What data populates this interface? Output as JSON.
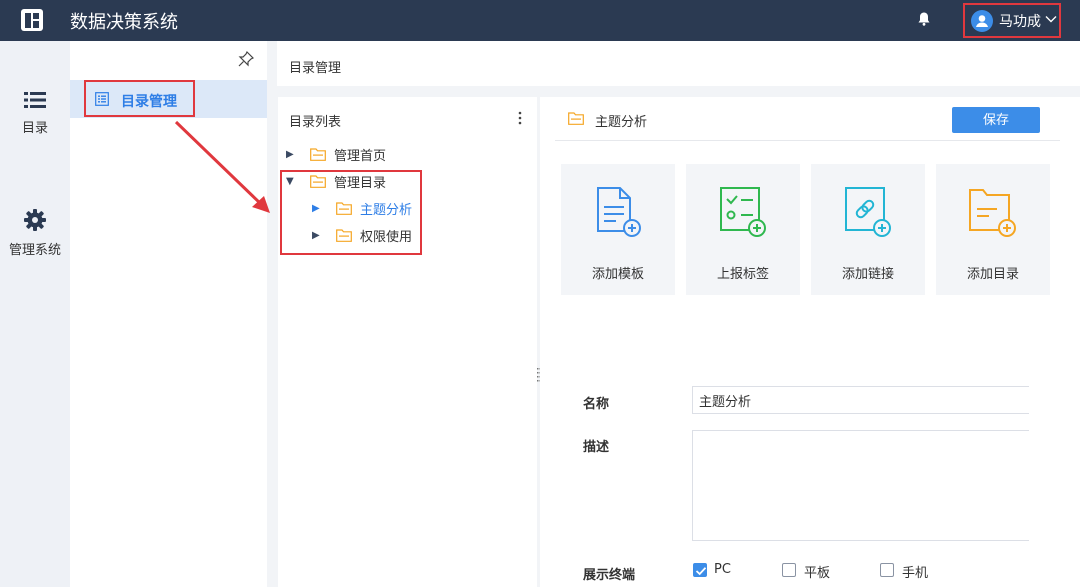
{
  "topbar": {
    "app_title": "数据决策系统",
    "user_name": "马功成"
  },
  "rail": {
    "items": [
      {
        "label": "目录"
      },
      {
        "label": "管理系统"
      }
    ]
  },
  "sidebar": {
    "active_item": "目录管理"
  },
  "breadcrumb": "目录管理",
  "tree": {
    "title": "目录列表",
    "nodes": [
      {
        "label": "管理首页"
      },
      {
        "label": "管理目录"
      },
      {
        "label": "主题分析"
      },
      {
        "label": "权限使用"
      }
    ]
  },
  "detail": {
    "title": "主题分析",
    "save_label": "保存",
    "cards": [
      {
        "label": "添加模板",
        "icon": "add-template-icon",
        "color": "#3c8de8"
      },
      {
        "label": "上报标签",
        "icon": "report-tag-icon",
        "color": "#2fb84f"
      },
      {
        "label": "添加链接",
        "icon": "add-link-icon",
        "color": "#22b5d4"
      },
      {
        "label": "添加目录",
        "icon": "add-folder-icon",
        "color": "#f5a623"
      }
    ],
    "form": {
      "name_label": "名称",
      "name_value": "主题分析",
      "desc_label": "描述",
      "desc_value": "",
      "terminal_label": "展示终端",
      "terminals": [
        {
          "label": "PC",
          "checked": true
        },
        {
          "label": "平板",
          "checked": false
        },
        {
          "label": "手机",
          "checked": false
        }
      ]
    }
  },
  "colors": {
    "topbar": "#2b3a52",
    "accent": "#3c8de8",
    "highlight_border": "#e0383e",
    "folder": "#f5a623"
  }
}
